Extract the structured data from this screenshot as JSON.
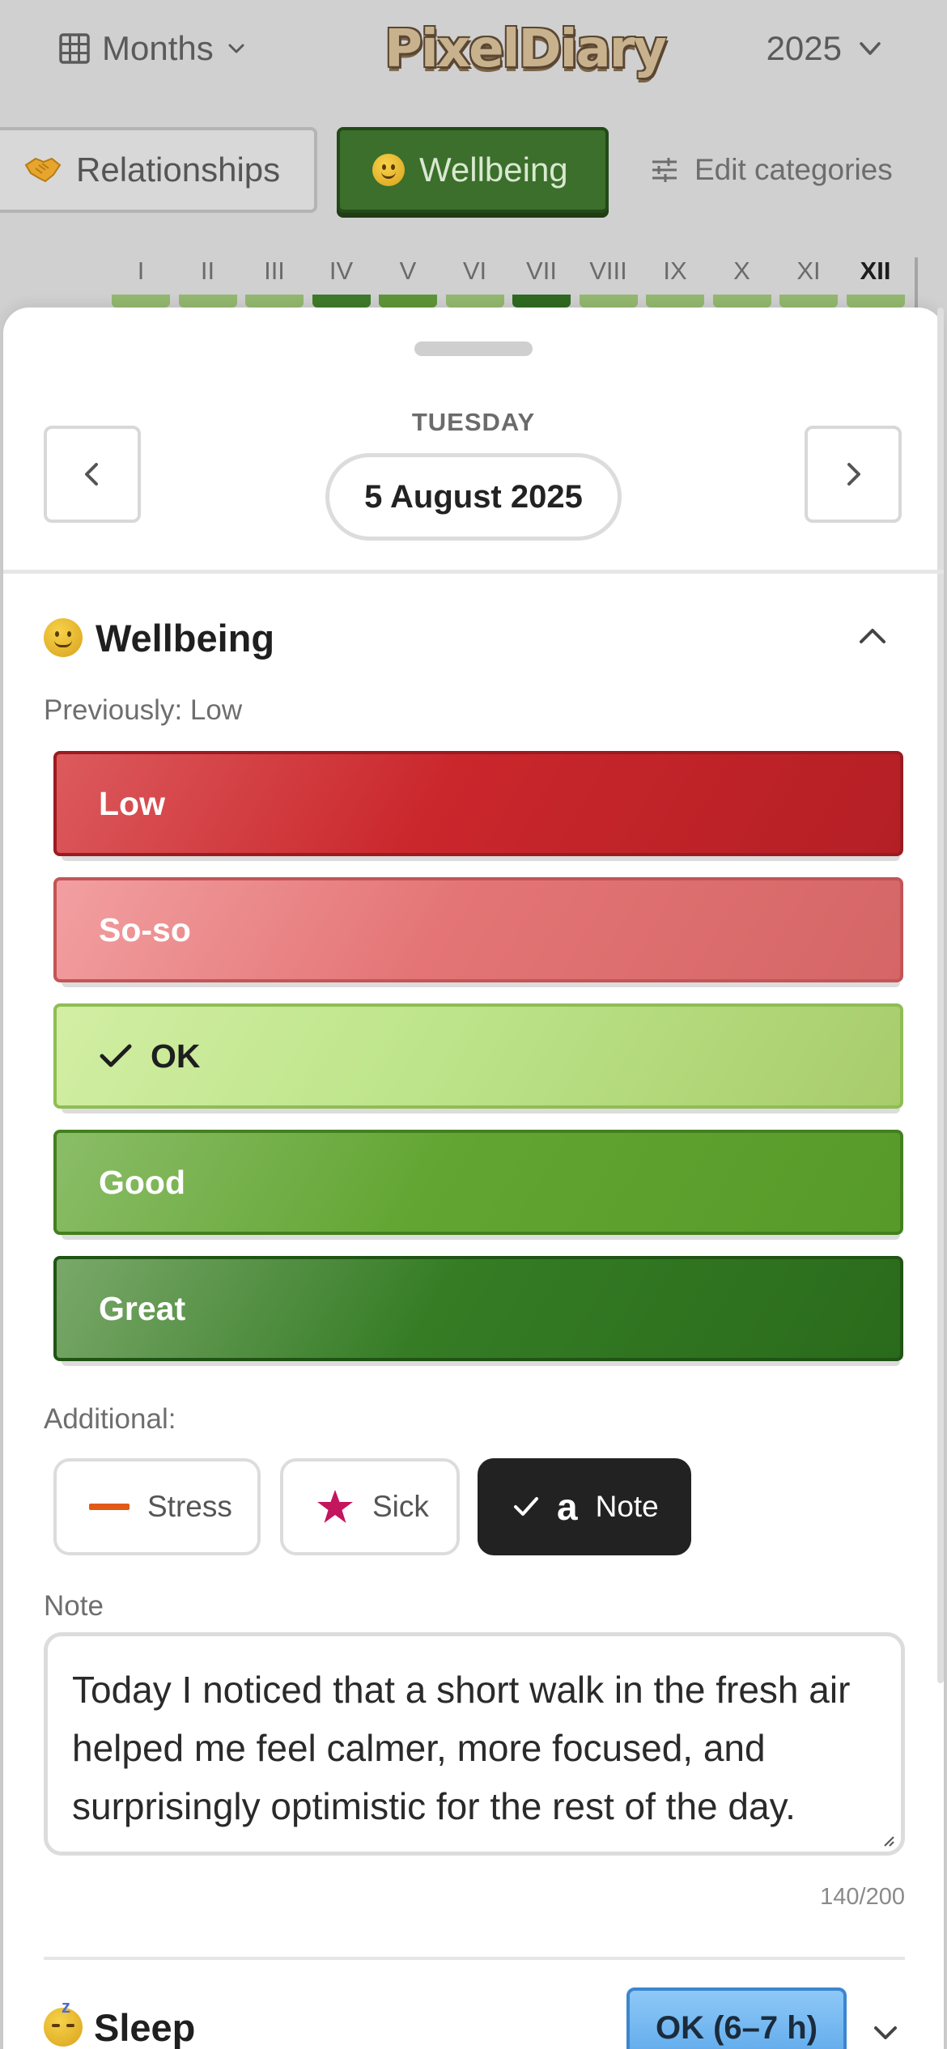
{
  "header": {
    "view_label": "Months",
    "logo_text": "PixelDiary",
    "year": "2025"
  },
  "categories": {
    "relationships": "Relationships",
    "wellbeing": "Wellbeing",
    "edit": "Edit categories"
  },
  "months": [
    {
      "label": "I",
      "color": "#93b86f"
    },
    {
      "label": "II",
      "color": "#93b86f"
    },
    {
      "label": "III",
      "color": "#93b86f"
    },
    {
      "label": "IV",
      "color": "#3f7a2a"
    },
    {
      "label": "V",
      "color": "#5e9538"
    },
    {
      "label": "VI",
      "color": "#93b86f"
    },
    {
      "label": "VII",
      "color": "#2f6a20"
    },
    {
      "label": "VIII",
      "color": "#93b86f"
    },
    {
      "label": "IX",
      "color": "#93b86f"
    },
    {
      "label": "X",
      "color": "#93b86f"
    },
    {
      "label": "XI",
      "color": "#93b86f"
    },
    {
      "label": "XII",
      "color": "#93b86f"
    }
  ],
  "active_month": "XII",
  "day": {
    "weekday": "TUESDAY",
    "date": "5 August 2025"
  },
  "wellbeing": {
    "title": "Wellbeing",
    "previously": "Previously: Low",
    "levels": [
      {
        "label": "Low",
        "selected": false
      },
      {
        "label": "So-so",
        "selected": false
      },
      {
        "label": "OK",
        "selected": true
      },
      {
        "label": "Good",
        "selected": false
      },
      {
        "label": "Great",
        "selected": false
      }
    ],
    "additional_label": "Additional:",
    "tags": {
      "stress": "Stress",
      "sick": "Sick",
      "note": "Note",
      "note_glyph": "a"
    },
    "note_label": "Note",
    "note_text": "Today I noticed that a short walk in the fresh air helped me feel calmer, more focused, and surprisingly optimistic for the rest of the day.",
    "char_count": "140/200"
  },
  "sleep": {
    "title": "Sleep",
    "value": "OK (6–7 h)"
  },
  "colors": {
    "low": "#c9262c",
    "soso": "#e47576",
    "ok": "#b8e086",
    "good": "#5aa02f",
    "great": "#2d6e1d",
    "stress": "#e35a18",
    "sick": "#c4155f"
  }
}
